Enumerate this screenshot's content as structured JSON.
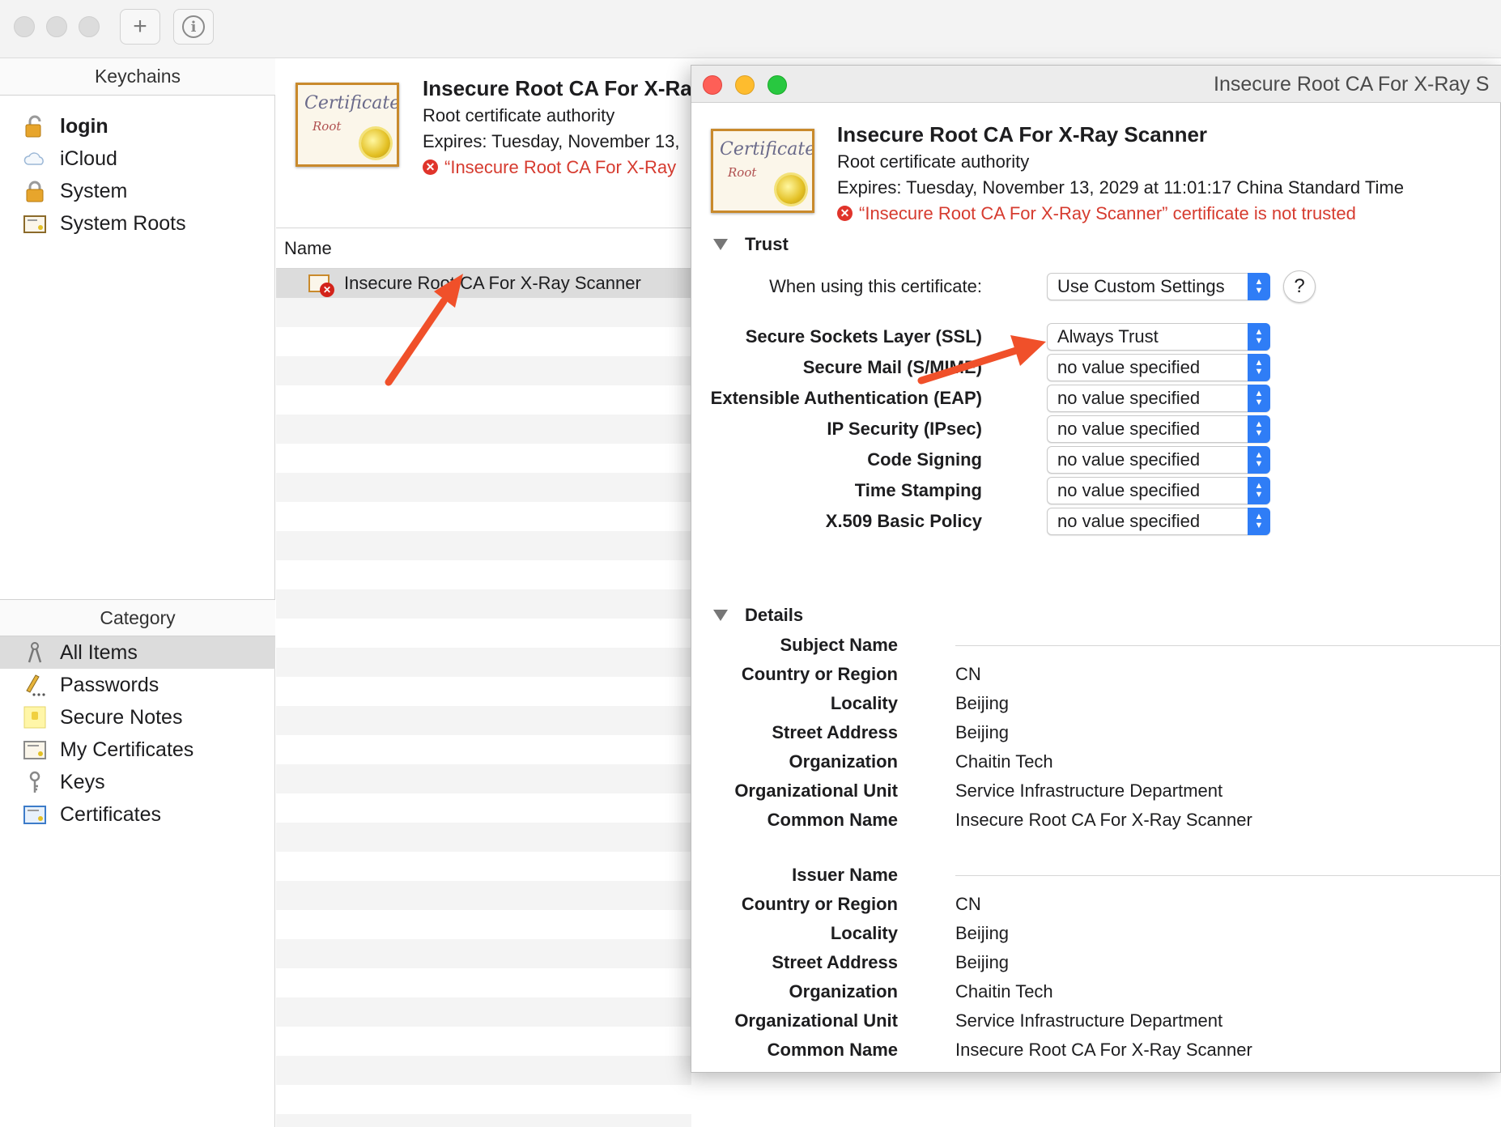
{
  "sidebar": {
    "keychains_header": "Keychains",
    "keychains": [
      {
        "label": "login",
        "icon": "unlocked-padlock-icon"
      },
      {
        "label": "iCloud",
        "icon": "cloud-icon"
      },
      {
        "label": "System",
        "icon": "padlock-icon"
      },
      {
        "label": "System Roots",
        "icon": "certificate-cabinet-icon"
      }
    ],
    "category_header": "Category",
    "categories": [
      {
        "label": "All Items",
        "icon": "keys-icon"
      },
      {
        "label": "Passwords",
        "icon": "pencil-icon"
      },
      {
        "label": "Secure Notes",
        "icon": "note-icon"
      },
      {
        "label": "My Certificates",
        "icon": "certificate-icon"
      },
      {
        "label": "Keys",
        "icon": "key-icon"
      },
      {
        "label": "Certificates",
        "icon": "certificate-icon"
      }
    ]
  },
  "summary": {
    "title": "Insecure Root CA For X-Ra",
    "subtitle": "Root certificate authority",
    "expires": "Expires: Tuesday, November 13,",
    "warning": "“Insecure Root CA For X-Ray"
  },
  "list": {
    "column_name": "Name",
    "selected_item": "Insecure Root CA For X-Ray Scanner"
  },
  "cert_window": {
    "window_title": "Insecure Root CA For X-Ray S",
    "title": "Insecure Root CA For X-Ray Scanner",
    "subtitle": "Root certificate authority",
    "expires": "Expires: Tuesday, November 13, 2029 at 11:01:17 China Standard Time",
    "warning": "“Insecure Root CA For X-Ray Scanner” certificate is not trusted",
    "trust": {
      "section_label": "Trust",
      "when_using_label": "When using this certificate:",
      "when_using_value": "Use Custom Settings",
      "help": "?",
      "policies": [
        {
          "label": "Secure Sockets Layer (SSL)",
          "value": "Always Trust"
        },
        {
          "label": "Secure Mail (S/MIME)",
          "value": "no value specified"
        },
        {
          "label": "Extensible Authentication (EAP)",
          "value": "no value specified"
        },
        {
          "label": "IP Security (IPsec)",
          "value": "no value specified"
        },
        {
          "label": "Code Signing",
          "value": "no value specified"
        },
        {
          "label": "Time Stamping",
          "value": "no value specified"
        },
        {
          "label": "X.509 Basic Policy",
          "value": "no value specified"
        }
      ]
    },
    "details": {
      "section_label": "Details",
      "subject": {
        "header": "Subject Name",
        "fields": [
          {
            "label": "Country or Region",
            "value": "CN"
          },
          {
            "label": "Locality",
            "value": "Beijing"
          },
          {
            "label": "Street Address",
            "value": "Beijing"
          },
          {
            "label": "Organization",
            "value": "Chaitin Tech"
          },
          {
            "label": "Organizational Unit",
            "value": "Service Infrastructure Department"
          },
          {
            "label": "Common Name",
            "value": "Insecure Root CA For X-Ray Scanner"
          }
        ]
      },
      "issuer": {
        "header": "Issuer Name",
        "fields": [
          {
            "label": "Country or Region",
            "value": "CN"
          },
          {
            "label": "Locality",
            "value": "Beijing"
          },
          {
            "label": "Street Address",
            "value": "Beijing"
          },
          {
            "label": "Organization",
            "value": "Chaitin Tech"
          },
          {
            "label": "Organizational Unit",
            "value": "Service Infrastructure Department"
          },
          {
            "label": "Common Name",
            "value": "Insecure Root CA For X-Ray Scanner"
          }
        ]
      }
    }
  },
  "colors": {
    "warning_red": "#d63b2f",
    "accent_blue": "#2f7df6",
    "annotation_arrow": "#f0502a",
    "close_red": "#fe5f57",
    "minimize_yellow": "#febc2e",
    "zoom_green": "#28c840"
  }
}
